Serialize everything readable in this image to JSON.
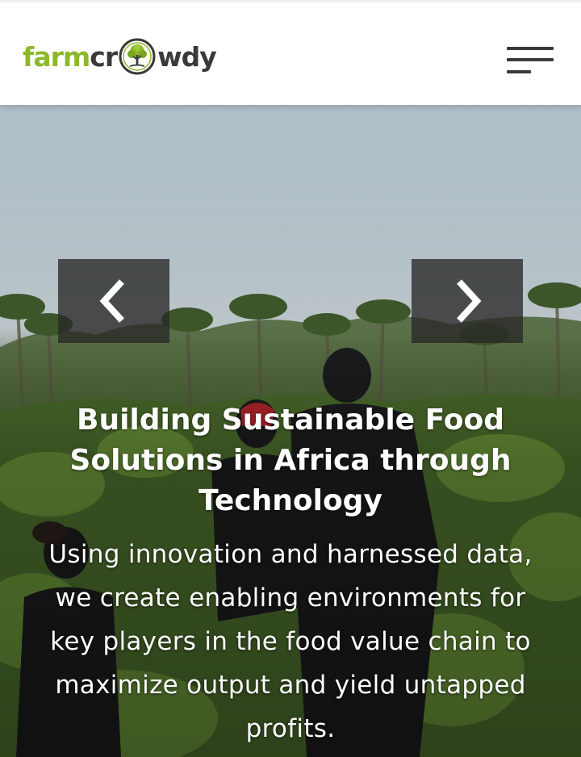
{
  "brand": {
    "logo_prefix": "farm",
    "logo_middle": "cr",
    "logo_suffix": "wdy",
    "logo_icon": "tree-icon",
    "green": "#8db82b",
    "dark": "#3a3a3a"
  },
  "header": {
    "menu_icon": "hamburger-menu-icon"
  },
  "hero": {
    "prev_icon": "chevron-left-icon",
    "next_icon": "chevron-right-icon",
    "title": "Building Sustainable Food Solutions in Africa through Technology",
    "subtitle": "Using innovation and harnessed data, we create enabling environments for key players in the food value chain to maximize output and yield untapped profits."
  }
}
